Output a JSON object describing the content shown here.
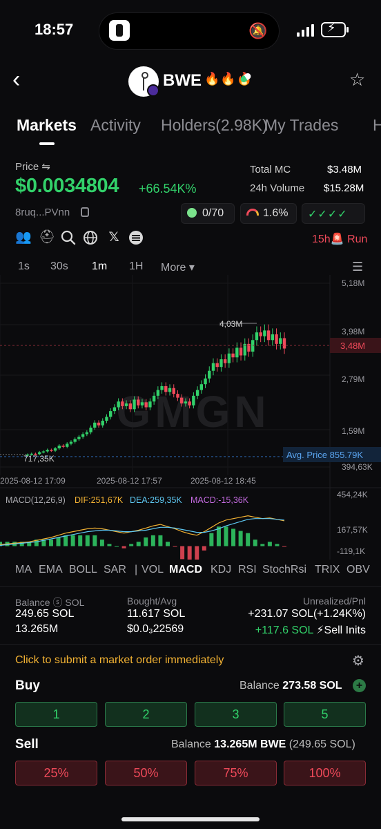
{
  "status_bar": {
    "time": "18:57",
    "mute_icon": "bell-slash-icon",
    "signal_icon": "signal-icon",
    "battery_icon": "battery-charging-icon"
  },
  "header": {
    "token_name": "BWE",
    "flames": "🔥🔥🔥",
    "back_icon": "chevron-left-icon",
    "star_icon": "star-outline-icon"
  },
  "tabs": [
    {
      "label": "Markets",
      "active": true
    },
    {
      "label": "Activity"
    },
    {
      "label": "Holders(2.98K)"
    },
    {
      "label": "My Trades"
    },
    {
      "label": "H"
    }
  ],
  "price": {
    "label": "Price ⇋",
    "value": "$0.0034804",
    "change": "+66.54K%",
    "address": "8ruq...PVnn"
  },
  "stats": {
    "mc_label": "Total MC",
    "mc_value": "$3.48M",
    "vol_label": "24h Volume",
    "vol_value": "$15.28M"
  },
  "chips": {
    "holders": "0/70",
    "gauge": "1.6%",
    "checks": "✓✓✓✓"
  },
  "socials": [
    "people-icon",
    "bot-icon",
    "search-icon",
    "globe-icon",
    "x-icon",
    "stack-icon"
  ],
  "run": {
    "label": "15h",
    "suffix": "Run",
    "color": "#f04a5a"
  },
  "timeframes": [
    {
      "label": "1s"
    },
    {
      "label": "30s"
    },
    {
      "label": "1m",
      "active": true
    },
    {
      "label": "1H"
    },
    {
      "label": "More ▾"
    }
  ],
  "chart": {
    "price_axis": [
      "5,18M",
      "3,98M",
      "2,79M",
      "1,59M",
      "394,63K"
    ],
    "current_price_label": "3,48M",
    "high_label": "4,03M",
    "low_label": "717,35K",
    "avg_price_label": "Avg. Price 855.79K",
    "time_axis": [
      "2025-08-12 17:09",
      "2025-08-12 17:57",
      "2025-08-12 18:45"
    ],
    "watermark": "GMGN",
    "macd_legend": {
      "name": "MACD(12,26,9)",
      "dif": "DIF:251,67K",
      "dea": "DEA:259,35K",
      "macd": "MACD:-15,36K"
    },
    "macd_axis": [
      "454,24K",
      "167,57K",
      "-119,1K"
    ],
    "colors": {
      "up": "#32d16a",
      "down": "#f04a5a",
      "dif": "#f2b233",
      "dea": "#5ec8f2",
      "macd": "#c46be0"
    }
  },
  "chart_data": {
    "type": "candlestick",
    "title": "",
    "y_unit": "market cap",
    "ylim": [
      394630,
      5180000
    ],
    "candles_mc_M": [
      0.72,
      0.74,
      0.73,
      0.78,
      0.8,
      0.84,
      0.82,
      0.88,
      0.95,
      0.92,
      1.0,
      1.05,
      1.12,
      1.18,
      1.25,
      1.3,
      1.42,
      1.55,
      1.48,
      1.6,
      1.7,
      1.85,
      1.95,
      2.1,
      1.98,
      2.05,
      1.9,
      2.15,
      2.0,
      2.08,
      1.95,
      2.1,
      2.25,
      2.4,
      2.5,
      2.35,
      2.45,
      2.3,
      2.2,
      2.05,
      2.1,
      2.0,
      2.25,
      2.4,
      2.55,
      2.7,
      2.9,
      3.1,
      3.0,
      3.2,
      3.1,
      3.35,
      3.25,
      3.5,
      3.3,
      3.6,
      3.4,
      3.7,
      3.9,
      3.8,
      3.95,
      3.7,
      3.85,
      3.6,
      3.75,
      3.48
    ],
    "macd_dif": [
      0.02,
      0.03,
      0.04,
      0.05,
      0.06,
      0.08,
      0.1,
      0.12,
      0.15,
      0.18,
      0.2,
      0.22,
      0.24,
      0.25,
      0.24,
      0.22,
      0.2,
      0.18,
      0.2,
      0.22,
      0.25,
      0.28,
      0.3,
      0.27,
      0.24,
      0.2,
      0.17,
      0.15,
      0.2,
      0.26,
      0.32,
      0.36,
      0.38,
      0.4,
      0.42,
      0.4,
      0.38,
      0.39,
      0.37,
      0.35
    ],
    "macd_dea": [
      0.01,
      0.02,
      0.03,
      0.04,
      0.05,
      0.06,
      0.08,
      0.1,
      0.12,
      0.14,
      0.16,
      0.18,
      0.2,
      0.21,
      0.22,
      0.22,
      0.21,
      0.2,
      0.2,
      0.21,
      0.22,
      0.24,
      0.26,
      0.26,
      0.25,
      0.23,
      0.21,
      0.19,
      0.19,
      0.21,
      0.24,
      0.28,
      0.31,
      0.34,
      0.37,
      0.38,
      0.38,
      0.38,
      0.37,
      0.36
    ]
  },
  "indicators": [
    "MA",
    "EMA",
    "BOLL",
    "SAR",
    "|",
    "VOL",
    "MACD",
    "KDJ",
    "RSI",
    "StochRsi",
    "TRIX",
    "OBV"
  ],
  "position": {
    "balance_label": "Balance",
    "balance_unit": "SOL",
    "balance_sol": "249.65 SOL",
    "balance_tokens": "13.265M",
    "bought_label": "Bought/Avg",
    "bought_sol": "11.617 SOL",
    "avg_price": "$0.0₃22569",
    "pnl_label": "Unrealized/Pnl",
    "pnl_total": "+231.07 SOL(+1.24K%)",
    "pnl_sol": "+117.6 SOL",
    "sell_inits": "Sell Inits"
  },
  "notice": "Click to submit a market order immediately",
  "buy": {
    "title": "Buy",
    "balance_label": "Balance",
    "balance_value": "273.58 SOL",
    "amounts": [
      "1",
      "2",
      "3",
      "5"
    ]
  },
  "sell": {
    "title": "Sell",
    "balance_label": "Balance",
    "balance_value": "13.265M BWE",
    "balance_sol": "(249.65 SOL)",
    "percents": [
      "25%",
      "50%",
      "75%",
      "100%"
    ]
  }
}
